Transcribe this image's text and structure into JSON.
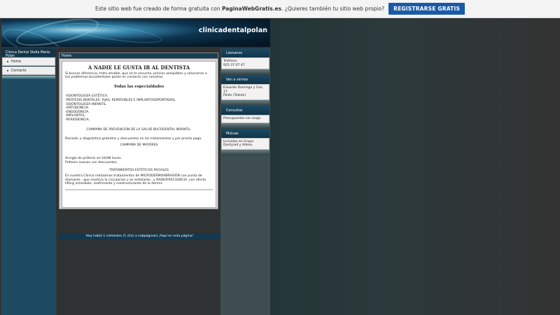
{
  "top_bar": {
    "message_prefix": "Este sitio web fue creado de forma gratuita con ",
    "brand": "PaginaWebGratis.es",
    "message_suffix": ". ¿Quieres también tu sitio web propio?",
    "register_button": "REGISTRARSE GRATIS",
    "button_color": "#1a5aa8"
  },
  "header": {
    "site_title": "clinicadentalpolan"
  },
  "sidebar": {
    "site_name": "Clinica Dental Stella Maria Polan",
    "items": [
      {
        "label": "Home"
      },
      {
        "label": "Contacto"
      }
    ]
  },
  "main": {
    "breadcrumb": "Home",
    "heading": "A NADIE LE GUSTA IR AL DENTISTA",
    "intro": "Si buscas diferencia, trato amable, que se te escuche, precios asequibles y soluciones a tus problemas bucodentales ponte en contacto con nosotros.",
    "specialties_title": "Todas las especialdades",
    "specialties": [
      "-ODONTOLOGÍA ESTÉTICA.",
      "-PRÓTESIS DENTALES: FIJAS, REMOVIBLES E IMPLANTOSOPORTADAS.",
      "-ODONTOLOGÍA INFANTIL.",
      "-ORTODONCIA.",
      "-ENDODONCIA.",
      "-IMPLANTES.",
      "-PERIODONCIA."
    ],
    "campaign_1": "CAMPAÑA DE PREVENCIÓN DE LA SALUD BUCODENTAL INFANTIL.",
    "campaign_1_text": "Revisión y diagnóstico gratuitos y descuentos en los tratamientos y por pronto pago.",
    "campaign_2": "CAMPAÑA DE MAYORES",
    "campaign_2_line1": "Arreglo de prótesis en 24/48 horas.",
    "campaign_2_line2": "Prótesis nuevas con descuentos.",
    "campaign_3": "TRATAMIENTOS ESTETICOS FACIALES",
    "campaign_3_text": "En nuestra Clínica realizamos tratamientos de MICRODERMOABRASIÓN con punta de diamante , que reactiva la circulacion y es exfoliante , y RADIOFRECUENCIA ,con efecto lifting inmediato, reafirmante y reestructurante de la dermis"
  },
  "footer": {
    "visitors": "Hoy había 1 visitantes (1 clics a subpáginas) ¡Aquí en esta página!"
  },
  "right_sidebar": {
    "widgets": [
      {
        "title": "Llamanos",
        "body": "Teléfono:\n925 37 07 47"
      },
      {
        "title": "Ven a vernos",
        "body": "Eduardo Domingo y Cea 17\nPolán (Toledo)"
      },
      {
        "title": "Consultas",
        "body": "Presupuestos sin cargo."
      },
      {
        "title": "Mutuas",
        "body": "Incluidas en Grupo Dentyred y Adesa."
      }
    ]
  }
}
